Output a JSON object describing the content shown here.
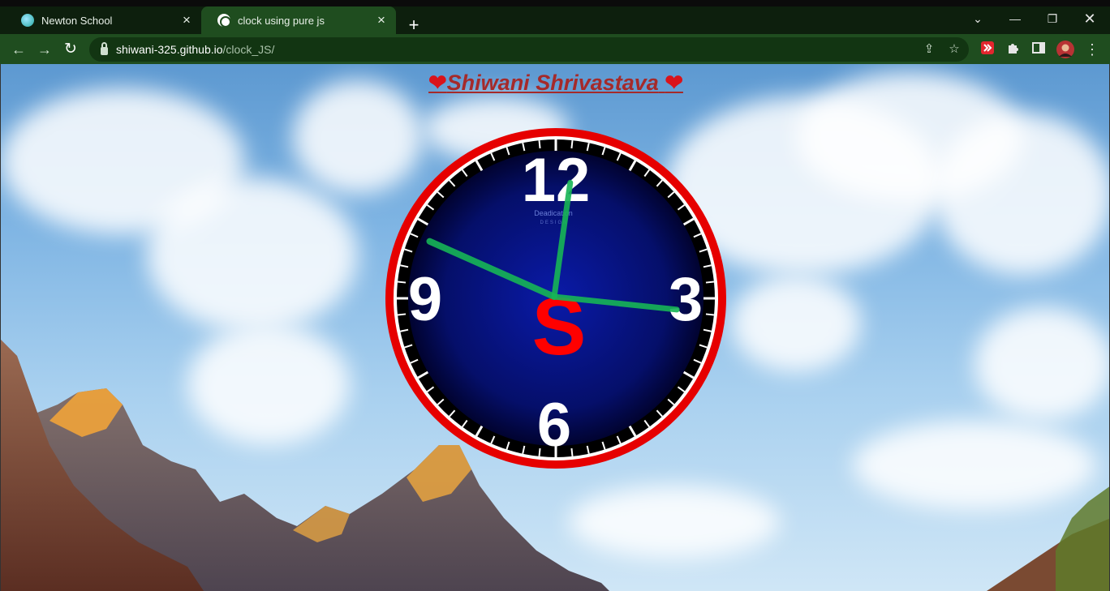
{
  "browser": {
    "tabs": [
      {
        "label": "Newton School",
        "active": false
      },
      {
        "label": "clock using pure js",
        "active": true
      }
    ],
    "url_host": "shiwani-325.github.io",
    "url_path": "/clock_JS/",
    "icons": [
      "back-icon",
      "forward-icon",
      "reload-icon",
      "lock-icon",
      "share-icon",
      "star-icon",
      "extension-icon",
      "puzzle-icon",
      "sidepanel-icon",
      "profile-avatar",
      "menu-icon"
    ]
  },
  "page": {
    "heading_name": "Shiwani Shrivastava",
    "heart": "❤",
    "clock": {
      "numerals": {
        "twelve": "12",
        "three": "3",
        "six": "6",
        "nine": "9"
      },
      "brand_text": "Deadication",
      "center_letter": "S",
      "hour_hand_angle_deg": 294,
      "minute_hand_angle_deg": 96,
      "second_hand_angle_deg": 8,
      "colors": {
        "ring": "#e60000",
        "dial_center": "#0a1aa8",
        "dial_edge": "#010330",
        "hands": "#17b556",
        "numerals": "#ffffff",
        "center_letter": "#ff0000"
      }
    },
    "colors": {
      "heading": "#a52a2a",
      "tab_bar": "#0d1f0d",
      "toolbar": "#1f4d1f"
    }
  }
}
